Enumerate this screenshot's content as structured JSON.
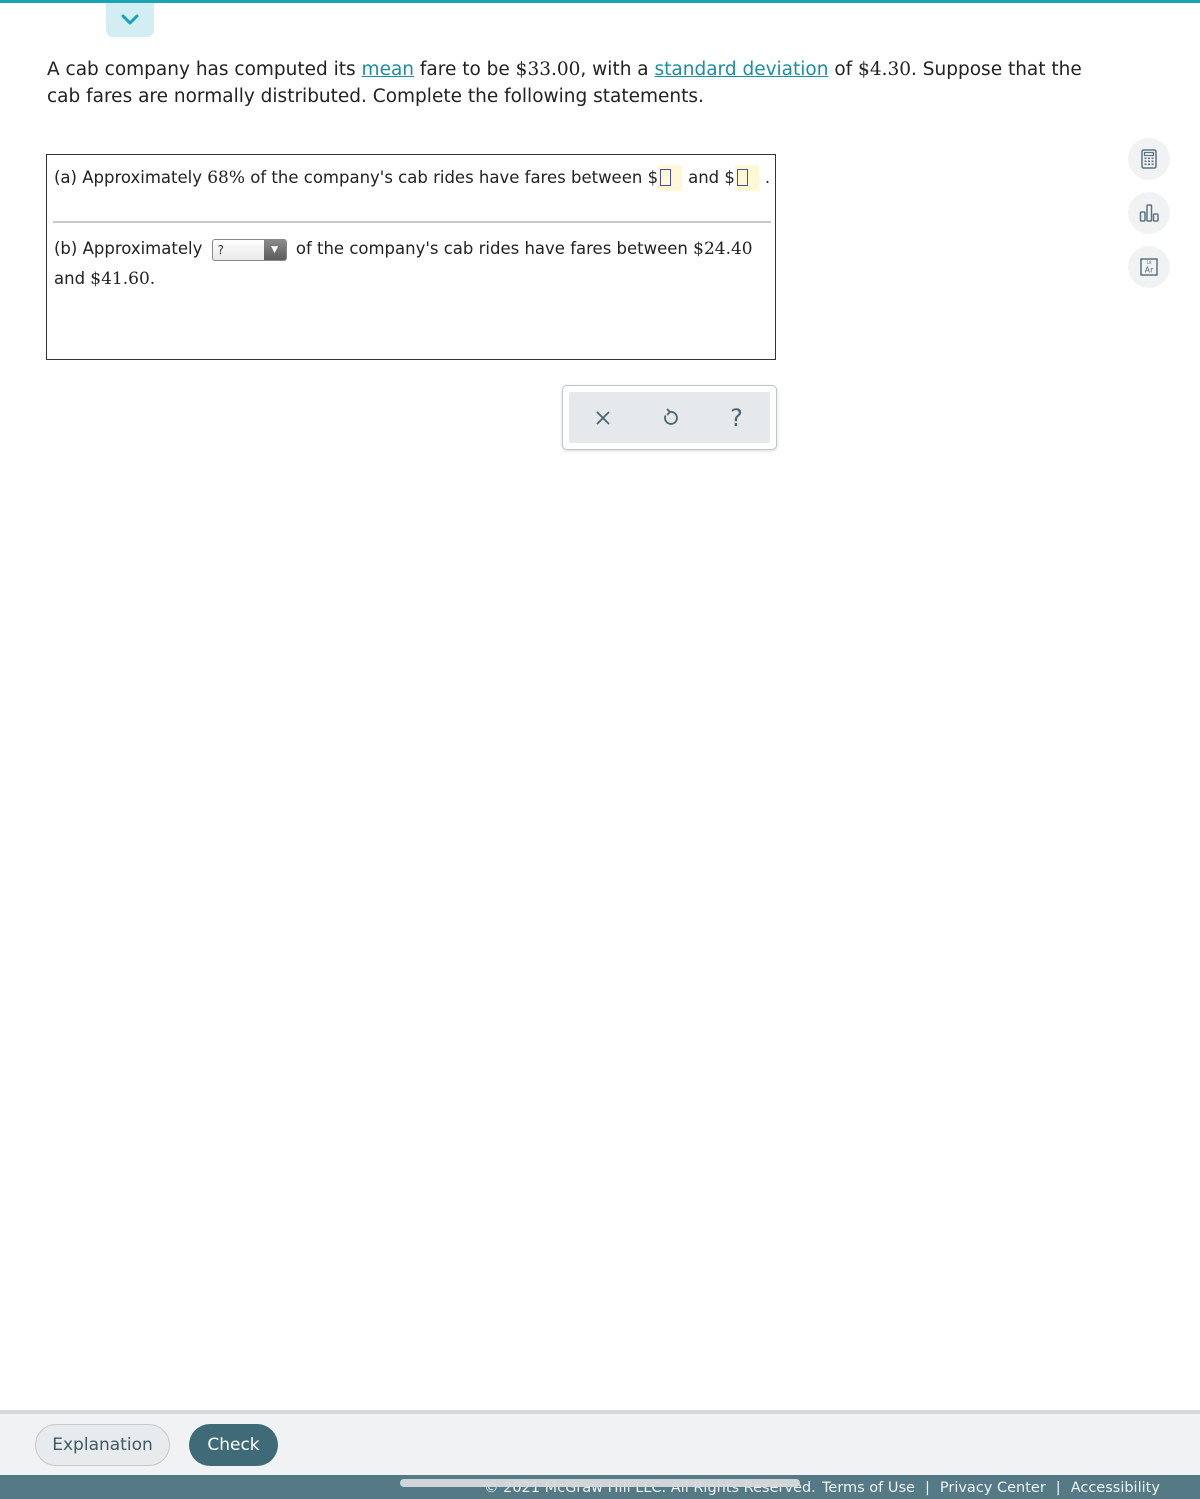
{
  "header": {
    "collapse_icon": "chevron-down-icon"
  },
  "prompt": {
    "part1": "A cab company has computed its ",
    "mean_link": "mean",
    "part2": " fare to be ",
    "mean_value": "$33.00",
    "part3": ", with a ",
    "sd_link": "standard deviation",
    "part4": " of ",
    "sd_value": "$4.30",
    "part5": ". Suppose that the cab fares are normally distributed. Complete the following statements."
  },
  "question_a": {
    "prefix": "(a) Approximately ",
    "percent": "68%",
    "middle": " of the company's cab rides have fares between $",
    "answer1": "",
    "and": "and $",
    "answer2": "",
    "suffix": "."
  },
  "question_b": {
    "prefix": "(b) Approximately",
    "select_value": "?",
    "middle": "of the company's cab rides have fares between ",
    "low": "$24.40",
    "and": " and ",
    "high": "$41.60",
    "suffix": "."
  },
  "toolbar": {
    "clear_icon": "close-icon",
    "undo_icon": "undo-icon",
    "help_icon": "help-icon",
    "help_label": "?"
  },
  "side_tools": [
    {
      "icon": "calculator-icon"
    },
    {
      "icon": "bar-chart-icon"
    },
    {
      "icon": "periodic-table-icon",
      "label": "Ar"
    }
  ],
  "actions": {
    "explanation_label": "Explanation",
    "check_label": "Check"
  },
  "footer": {
    "copyright": "© 2021 McGraw Hill LLC. All Rights Reserved.",
    "links": [
      "Terms of Use",
      "Privacy Center",
      "Accessibility"
    ],
    "separator": "|"
  }
}
